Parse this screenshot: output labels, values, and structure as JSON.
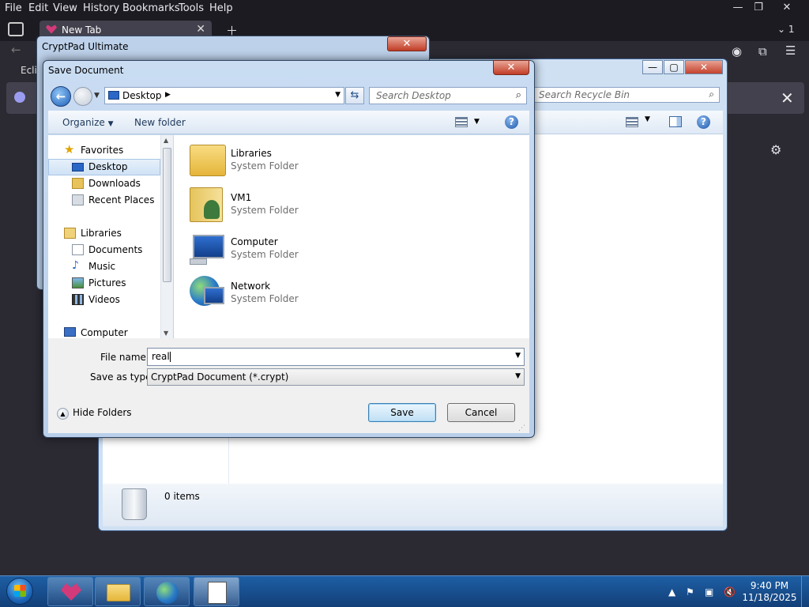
{
  "firefox": {
    "menu": [
      "File",
      "Edit",
      "View",
      "History",
      "Bookmarks",
      "Tools",
      "Help"
    ],
    "tab_title": "New Tab",
    "tab_count": "1",
    "bookmark_label": "Ecli"
  },
  "explorer": {
    "search_placeholder": "Search Recycle Bin",
    "items_count": "0 items"
  },
  "cryptpad": {
    "title": "CryptPad Ultimate",
    "close": "✕"
  },
  "dialog": {
    "title": "Save Document",
    "close": "✕",
    "address": "Desktop",
    "search_placeholder": "Search Desktop",
    "toolbar": {
      "organize": "Organize",
      "new_folder": "New folder"
    },
    "nav": {
      "favorites": "Favorites",
      "desktop": "Desktop",
      "downloads": "Downloads",
      "recent": "Recent Places",
      "libraries": "Libraries",
      "documents": "Documents",
      "music": "Music",
      "pictures": "Pictures",
      "videos": "Videos",
      "computer": "Computer"
    },
    "files": [
      {
        "name": "Libraries",
        "type": "System Folder"
      },
      {
        "name": "VM1",
        "type": "System Folder"
      },
      {
        "name": "Computer",
        "type": "System Folder"
      },
      {
        "name": "Network",
        "type": "System Folder"
      }
    ],
    "file_name_label": "File name:",
    "file_name_value": "real",
    "save_type_label": "Save as type:",
    "save_type_value": "CryptPad Document (*.crypt)",
    "hide_folders": "Hide Folders",
    "save": "Save",
    "cancel": "Cancel"
  },
  "taskbar": {
    "time": "9:40 PM",
    "date": "11/18/2025"
  },
  "colors": {
    "accent": "#1e5fb8",
    "taskbar": "#1d5fa5",
    "close_red": "#c13d27"
  }
}
